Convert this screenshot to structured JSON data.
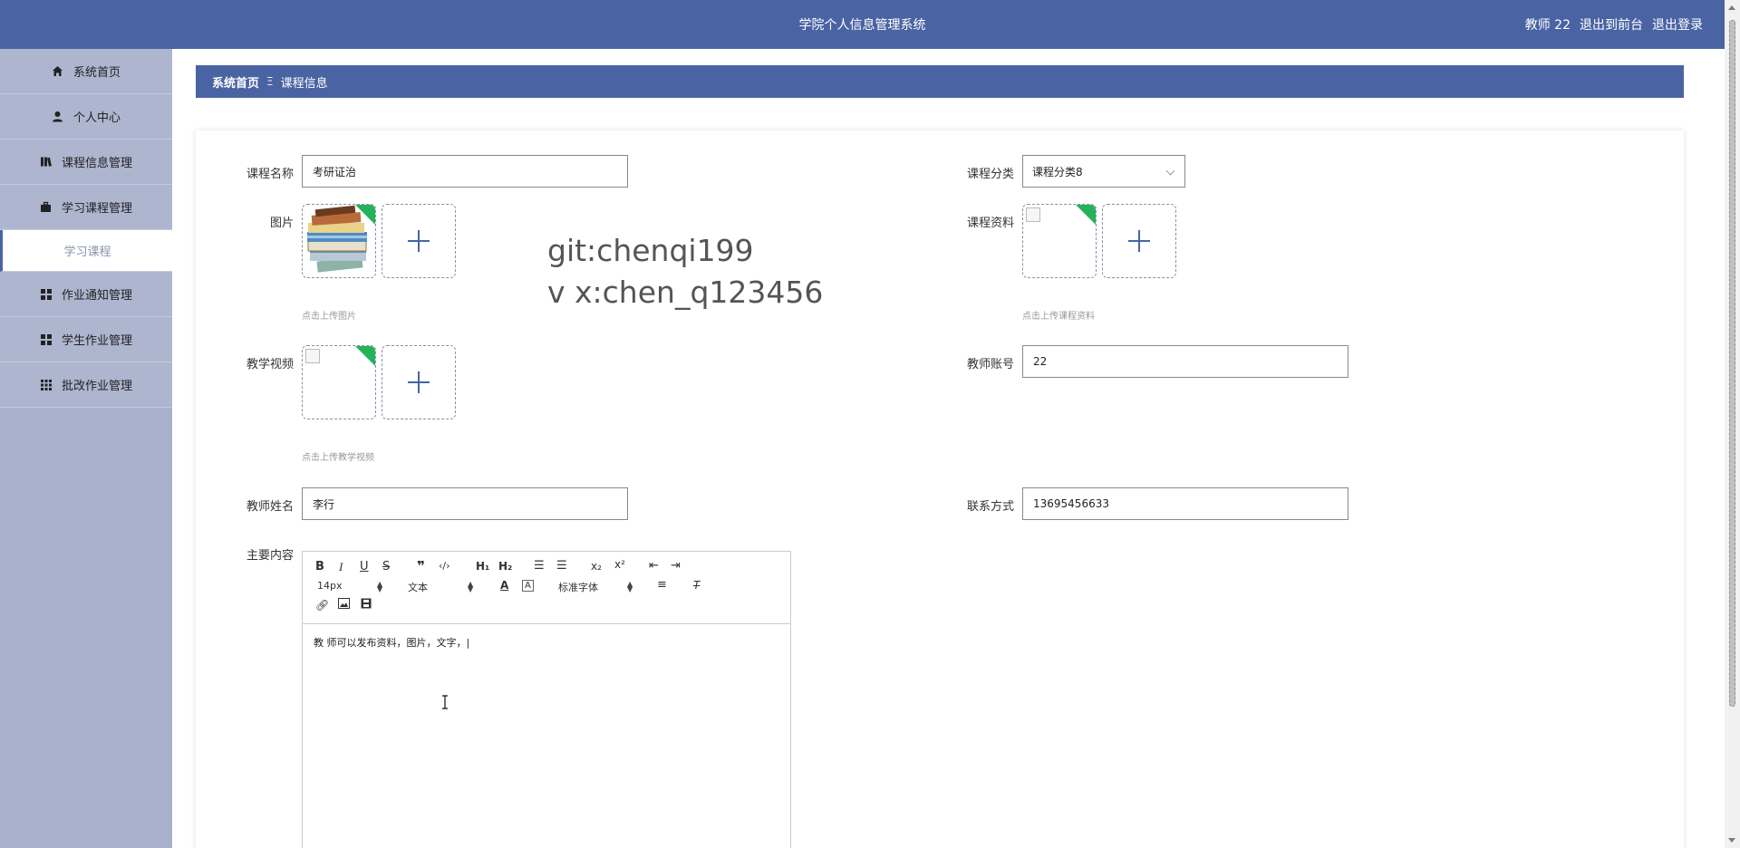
{
  "app": {
    "title": "学院个人信息管理系统",
    "user": "教师 22",
    "back_front": "退出到前台",
    "logout": "退出登录"
  },
  "sidebar": {
    "items": [
      {
        "label": "系统首页",
        "icon": "home-icon"
      },
      {
        "label": "个人中心",
        "icon": "user-icon"
      },
      {
        "label": "课程信息管理",
        "icon": "book-icon"
      },
      {
        "label": "学习课程管理",
        "icon": "briefcase-icon"
      }
    ],
    "sub_active": "学习课程",
    "items2": [
      {
        "label": "作业通知管理",
        "icon": "grid-icon"
      },
      {
        "label": "学生作业管理",
        "icon": "grid-icon"
      },
      {
        "label": "批改作业管理",
        "icon": "grid9-icon"
      }
    ]
  },
  "breadcrumb": {
    "home": "系统首页",
    "sep": "Ξ",
    "current": "课程信息"
  },
  "form": {
    "course_name_label": "课程名称",
    "course_name": "考研证治",
    "category_label": "课程分类",
    "category": "课程分类8",
    "image_label": "图片",
    "image_hint": "点击上传图片",
    "material_label": "课程资料",
    "material_hint": "点击上传课程资料",
    "video_label": "教学视频",
    "video_hint": "点击上传教学视频",
    "teacher_account_label": "教师账号",
    "teacher_account": "22",
    "teacher_name_label": "教师姓名",
    "teacher_name": "李行",
    "contact_label": "联系方式",
    "contact": "13695456633",
    "content_label": "主要内容"
  },
  "editor": {
    "font_size": "14px",
    "block": "文本",
    "font_family": "标准字体",
    "text": "教 师可以发布资料，图片，文字，|"
  },
  "watermark": {
    "line1": "git:chenqi199",
    "line2": "v x:chen_q123456"
  }
}
